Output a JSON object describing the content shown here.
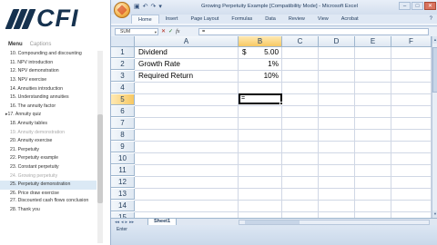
{
  "left_panel": {
    "logo": {
      "text": "CFI"
    },
    "tabs": [
      "Menu",
      "Captions"
    ],
    "lessons": [
      {
        "label": "10. Compounding and discounting",
        "state": "wrap"
      },
      {
        "label": "11. NPV introduction",
        "state": "normal"
      },
      {
        "label": "12. NPV demonstration",
        "state": "normal"
      },
      {
        "label": "13. NPV exercise",
        "state": "normal"
      },
      {
        "label": "14. Annuities introduction",
        "state": "normal"
      },
      {
        "label": "15. Understanding annuities",
        "state": "normal"
      },
      {
        "label": "16. The annuity factor",
        "state": "normal"
      },
      {
        "label": "17. Annuity quiz",
        "state": "playing"
      },
      {
        "label": "18. Annuity tables",
        "state": "normal"
      },
      {
        "label": "19. Annuity demonstration",
        "state": "muted"
      },
      {
        "label": "20. Annuity exercise",
        "state": "normal"
      },
      {
        "label": "21. Perpetuity",
        "state": "normal"
      },
      {
        "label": "22. Perpetuity example",
        "state": "normal"
      },
      {
        "label": "23. Constant perpetuity",
        "state": "normal"
      },
      {
        "label": "24. Growing perpetuity",
        "state": "muted"
      },
      {
        "label": "25. Perpetuity demonstration",
        "state": "current"
      },
      {
        "label": "26. Price draw exercise",
        "state": "normal"
      },
      {
        "label": "27. Discounted cash flows conclusion",
        "state": "wrap"
      },
      {
        "label": "28. Thank you",
        "state": "normal"
      }
    ]
  },
  "excel": {
    "window_title": "Growing Perpetuity Example  [Compatibility Mode] - Microsoft Excel",
    "qat_icons": [
      "save-icon",
      "undo-icon",
      "redo-icon",
      "dropdown-icon"
    ],
    "qat_glyphs": [
      "▣",
      "↶",
      "↷",
      "▾"
    ],
    "window_controls": {
      "minimize": "–",
      "maximize": "□",
      "close": "✕"
    },
    "ribbon_tabs": [
      "Home",
      "Insert",
      "Page Layout",
      "Formulas",
      "Data",
      "Review",
      "View",
      "Acrobat"
    ],
    "help_glyph": "?",
    "name_box": "SUM",
    "formula_buttons": {
      "cancel": "✕",
      "enter": "✓",
      "fx": "fx"
    },
    "formula_value": "=",
    "columns": [
      "A",
      "B",
      "C",
      "D",
      "E",
      "F"
    ],
    "selected_column": "B",
    "rows": [
      "1",
      "2",
      "3",
      "4",
      "5",
      "6",
      "7",
      "8",
      "9",
      "10",
      "11",
      "12",
      "13",
      "14",
      "15"
    ],
    "selected_row": "5",
    "cells": {
      "A1": "Dividend",
      "A2": "Growth Rate",
      "A3": "Required Return",
      "B1_currency": "$",
      "B1_value": "5.00",
      "B2": "1%",
      "B3": "10%"
    },
    "active_cell": {
      "ref": "B5",
      "value": "="
    },
    "sheet_tab": "Sheet1",
    "sheet_nav": [
      "◂◂",
      "◂",
      "▸",
      "▸▸"
    ],
    "status": "Enter"
  }
}
